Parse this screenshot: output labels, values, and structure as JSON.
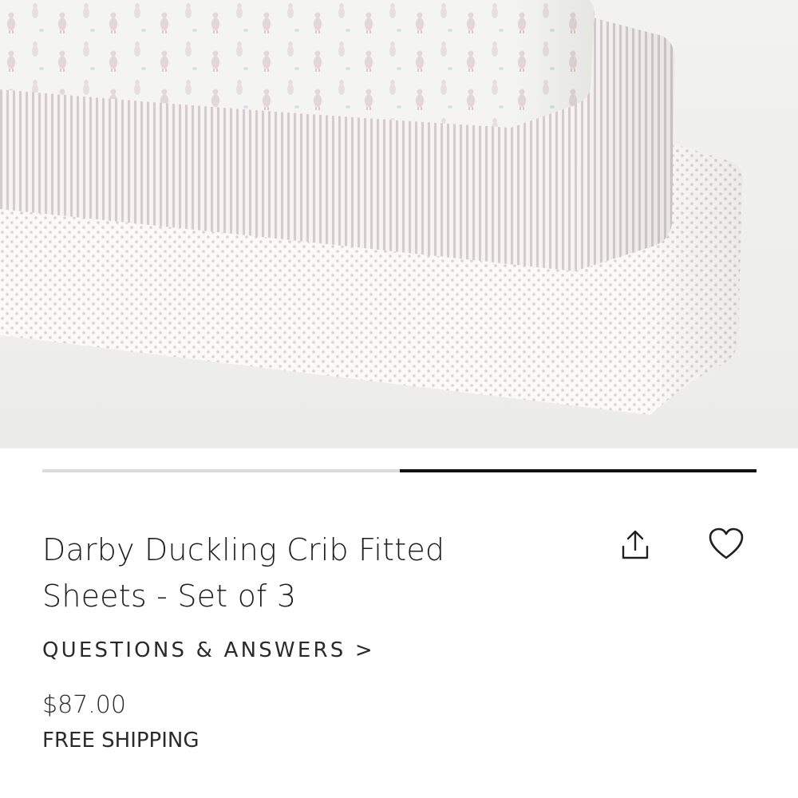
{
  "product": {
    "title": "Darby Duckling Crib Fitted Sheets - Set of 3",
    "questions_link": "QUESTIONS & ANSWERS >",
    "price": "$87.00",
    "shipping": "FREE SHIPPING"
  },
  "carousel": {
    "current_slide": 2,
    "total_slides": 2
  },
  "icons": {
    "share": "share-upload-icon",
    "favorite": "heart-outline-icon"
  },
  "colors": {
    "text": "#1f1f1f",
    "indicator_active": "#111111",
    "indicator_track": "#dcdcdc",
    "stripe": "#cdc4c6",
    "dot": "#cfc9c2",
    "duck": "#b9a6a3"
  }
}
